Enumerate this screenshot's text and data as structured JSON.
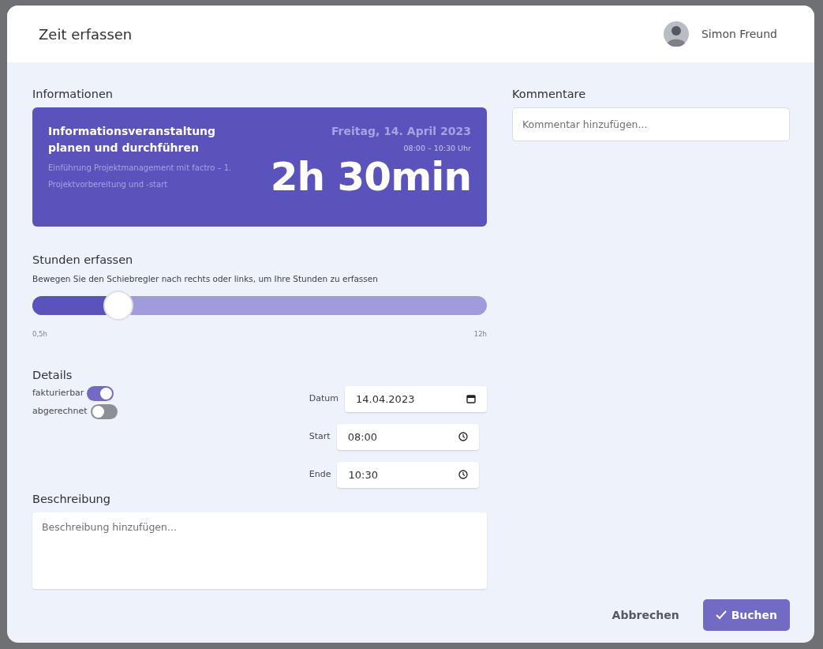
{
  "dialog": {
    "title": "Zeit erfassen",
    "user": {
      "name": "Simon Freund"
    }
  },
  "information": {
    "heading": "Informationen",
    "task": "Informationsveranstaltung planen und durchführen",
    "project": "Einführung Projektmanagement mit factro – 1. Projektvorbereitung und -start",
    "date": "Freitag, 14. April 2023",
    "time_range": "08:00 – 10:30 Uhr",
    "duration": "2h 30min"
  },
  "hours": {
    "heading": "Stunden erfassen",
    "hint": "Bewegen Sie den Schiebregler nach rechts oder links, um Ihre Stunden zu erfassen",
    "level": 0.19,
    "min_label": "0,5h",
    "max_label": "12h"
  },
  "details": {
    "heading": "Details",
    "toggles": [
      {
        "label": "fakturierbar",
        "on": true
      },
      {
        "label": "abgerechnet",
        "on": false
      }
    ],
    "fields": [
      {
        "label": "Datum",
        "value": "14.04.2023",
        "kind": "date"
      },
      {
        "label": "Start",
        "value": "08:00",
        "kind": "time"
      },
      {
        "label": "Ende",
        "value": "10:30",
        "kind": "time"
      }
    ]
  },
  "description": {
    "heading": "Beschreibung",
    "placeholder": "Beschreibung hinzufügen..."
  },
  "comments": {
    "heading": "Kommentare",
    "placeholder": "Kommentar hinzufügen..."
  },
  "buttons": [
    {
      "label": "Abbrechen",
      "kind": "cancel"
    },
    {
      "label": "Buchen",
      "kind": "primary"
    }
  ]
}
